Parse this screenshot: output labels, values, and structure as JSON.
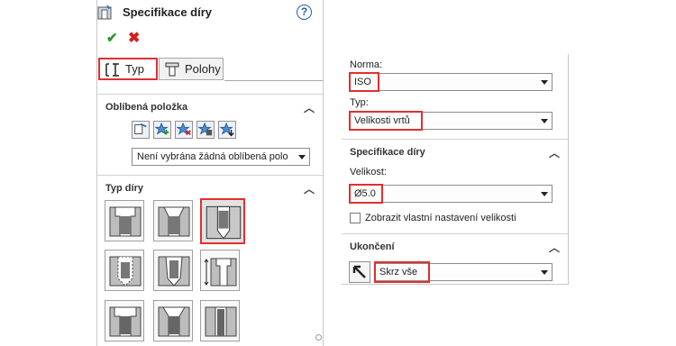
{
  "left_panel": {
    "title": "Specifikace díry",
    "help": "?",
    "tabs": [
      {
        "label": "Typ"
      },
      {
        "label": "Polohy"
      }
    ],
    "favorites": {
      "header": "Oblíbená položka",
      "dropdown_value": "Není vybrána žádná oblíbená polo"
    },
    "hole_type": {
      "header": "Typ díry"
    }
  },
  "right_panel": {
    "norma_label": "Norma:",
    "norma_value": "ISO",
    "typ_label": "Typ:",
    "typ_value": "Velikosti vrtů",
    "spec_header": "Specifikace díry",
    "velikost_label": "Velikost:",
    "velikost_value": "Ø5.0",
    "custom_size_label": "Zobrazit vlastní nastavení velikosti",
    "end_header": "Ukončení",
    "end_value": "Skrz vše"
  },
  "colors": {
    "highlight": "#e03030",
    "accept": "#2a9a2a",
    "cancel": "#d22020",
    "help": "#2a5ea8"
  }
}
